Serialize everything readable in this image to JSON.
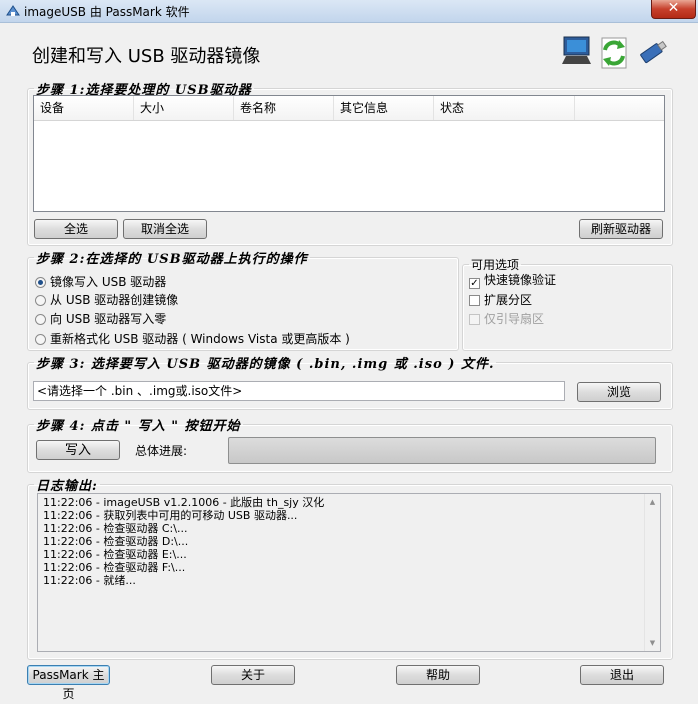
{
  "window": {
    "title": "imageUSB 由 PassMark 软件",
    "close_glyph": "✕"
  },
  "header": {
    "title": "创建和写入 USB 驱动器镜像",
    "icons": [
      "computer-icon",
      "refresh-arrows-icon",
      "usb-drive-icon"
    ]
  },
  "step1": {
    "legend": "步骤 1:选择要处理的 USB驱动器",
    "columns": [
      "设备",
      "大小",
      "卷名称",
      "其它信息",
      "状态"
    ],
    "rows": [],
    "select_all": "全选",
    "deselect_all": "取消全选",
    "refresh": "刷新驱动器"
  },
  "step2": {
    "legend": "步骤 2:在选择的 USB驱动器上执行的操作",
    "options": [
      {
        "label": "镜像写入 USB 驱动器",
        "selected": true
      },
      {
        "label": "从 USB 驱动器创建镜像",
        "selected": false
      },
      {
        "label": "向 USB 驱动器写入零",
        "selected": false
      },
      {
        "label": "重新格式化 USB 驱动器 ( Windows Vista 或更高版本 )",
        "selected": false
      }
    ]
  },
  "available_options": {
    "legend": "可用选项",
    "items": [
      {
        "label": "快速镜像验证",
        "checked": true,
        "enabled": true
      },
      {
        "label": "扩展分区",
        "checked": false,
        "enabled": true
      },
      {
        "label": "仅引导扇区",
        "checked": false,
        "enabled": false
      }
    ]
  },
  "step3": {
    "legend": "步骤 3: 选择要写入 USB 驱动器的镜像 ( .bin, .img 或 .iso ) 文件.",
    "file_value": "<请选择一个 .bin 、.img或.iso文件>",
    "browse": "浏览"
  },
  "step4": {
    "legend": "步骤 4: 点击 \" 写入 \" 按钮开始",
    "write": "写入",
    "progress_label": "总体进展:",
    "progress_percent": 0
  },
  "log": {
    "legend": "日志输出:",
    "lines": [
      "11:22:06 - imageUSB v1.2.1006 - 此版由 th_sjy 汉化",
      "11:22:06 - 获取列表中可用的可移动 USB 驱动器...",
      "11:22:06 - 检查驱动器 C:\\...",
      "11:22:06 - 检查驱动器 D:\\...",
      "11:22:06 - 检查驱动器 E:\\...",
      "11:22:06 - 检查驱动器 F:\\...",
      "11:22:06 - 就绪..."
    ]
  },
  "footer": {
    "passmark": "PassMark 主页",
    "about": "关于",
    "help": "帮助",
    "exit": "退出"
  }
}
